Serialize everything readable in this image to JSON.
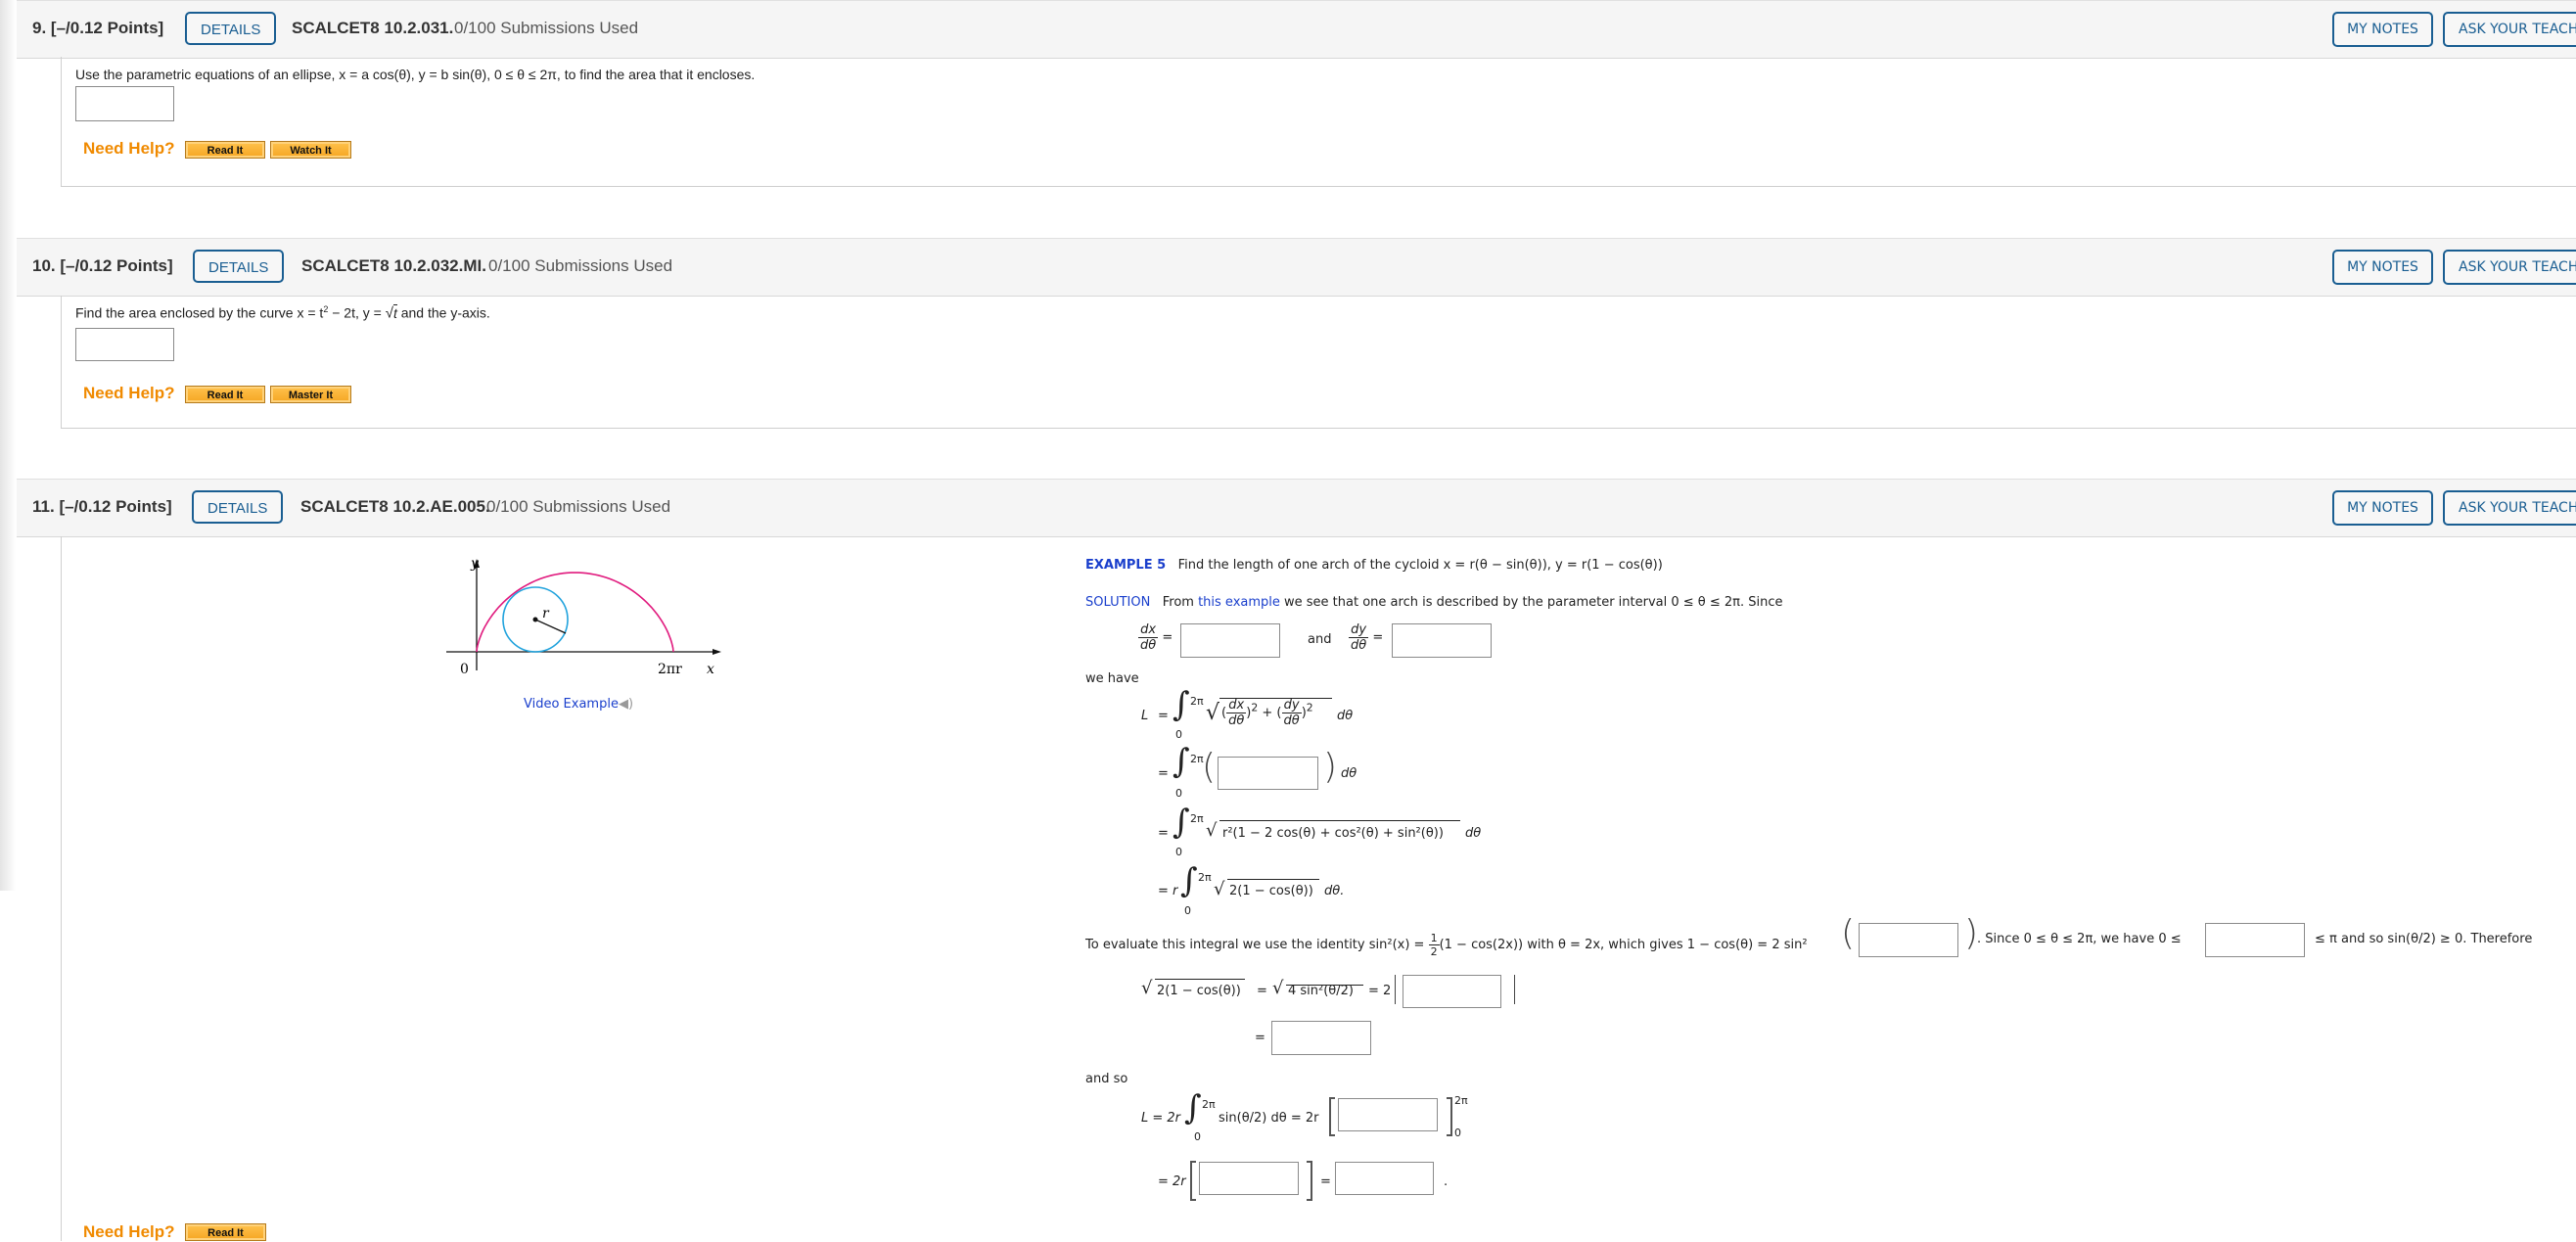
{
  "questions": [
    {
      "number": "9.",
      "points": "[–/0.12 Points]",
      "details_label": "DETAILS",
      "code": "SCALCET8 10.2.031.",
      "submissions": "0/100 Submissions Used",
      "my_notes_label": "MY NOTES",
      "ask_teacher_label": "ASK YOUR TEACHER",
      "prompt": "Use the parametric equations of an ellipse,  x = a cos(θ), y = b sin(θ), 0 ≤ θ ≤ 2π,  to find the area that it encloses.",
      "need_help": "Need Help?",
      "help_buttons": [
        "Read It",
        "Watch It"
      ]
    },
    {
      "number": "10.",
      "points": "[–/0.12 Points]",
      "details_label": "DETAILS",
      "code": "SCALCET8 10.2.032.MI.",
      "submissions": "0/100 Submissions Used",
      "my_notes_label": "MY NOTES",
      "ask_teacher_label": "ASK YOUR TEACHER",
      "prompt_a": "Find the area enclosed by the curve  x = t",
      "prompt_sup": "2",
      "prompt_b": " − 2t, y = ",
      "prompt_sqrt": "t",
      "prompt_c": "  and the y-axis.",
      "need_help": "Need Help?",
      "help_buttons": [
        "Read It",
        "Master It"
      ]
    },
    {
      "number": "11.",
      "points": "[–/0.12 Points]",
      "details_label": "DETAILS",
      "code": "SCALCET8 10.2.AE.005.",
      "submissions": "0/100 Submissions Used",
      "my_notes_label": "MY NOTES",
      "ask_teacher_label": "ASK YOUR TEACHER",
      "need_help": "Need Help?",
      "help_buttons": [
        "Read It"
      ]
    }
  ],
  "figure": {
    "y_label": "y",
    "x_label": "x",
    "origin_label": "0",
    "end_label": "2πr",
    "radius_label": "r",
    "curve_color": "#e0197d",
    "circle_color": "#22a3dd",
    "video_link": "Video Example",
    "speaker_icon": "speaker-icon"
  },
  "example": {
    "title": "EXAMPLE 5",
    "statement": "Find the length of one arch of the cycloid  x = r(θ − sin(θ)),   y = r(1 − cos(θ))",
    "solution_label": "SOLUTION",
    "solution_pre": "From ",
    "solution_link": "this example",
    "solution_post": " we see that one arch is described by the parameter interval  0 ≤ θ ≤ 2π.  Since",
    "dx": "dx",
    "dy": "dy",
    "dtheta": "dθ",
    "eq": "=",
    "and": "and",
    "we_have": "we have",
    "L": "L",
    "upper": "2π",
    "lower": "0",
    "line3_radicand": "r²(1 − 2 cos(θ) + cos²(θ) + sin²(θ))",
    "line4_radicand": "2(1 − cos(θ))",
    "d_theta_end": "dθ.",
    "identity_text_a": "To evaluate this integral we use the identity  sin²(x) = ",
    "half_n": "1",
    "half_d": "2",
    "identity_text_b": "(1 − cos(2x))  with  θ = 2x,  which gives  1 − cos(θ) = 2 sin²",
    "since_text": ".  Since  0 ≤ θ ≤ 2π,  we have  0 ≤",
    "le_pi_text": "≤ π  and so  sin(θ/2) ≥ 0.  Therefore",
    "sqrt_lhs": "2(1 − cos(θ))",
    "sqrt_mid": "4 sin²(θ/2)",
    "two": "= 2",
    "and_so": "and so",
    "L_eq": "L  =  2r",
    "sin_half": "sin(θ/2) dθ  = 2r",
    "eq_2r": "=  2r",
    "period": "."
  }
}
